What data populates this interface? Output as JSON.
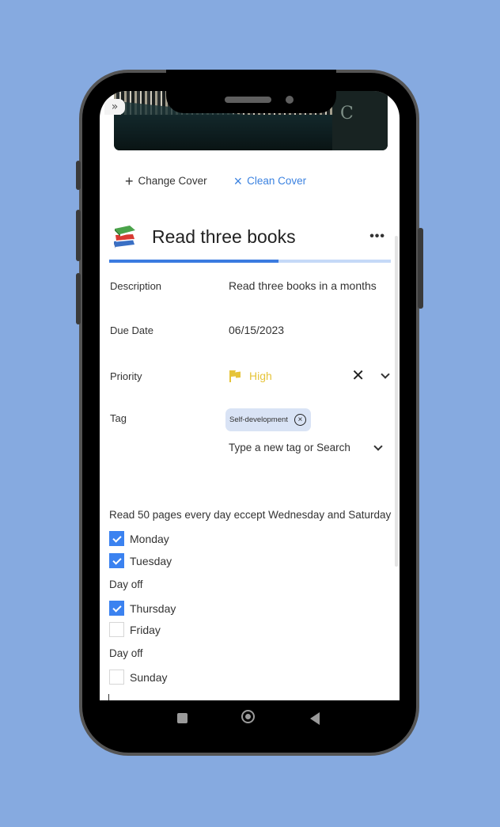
{
  "colors": {
    "background": "#86aae0",
    "accent": "#3b82e0",
    "priority_high": "#e6c43a",
    "tag_chip_bg": "#d9e3f5"
  },
  "cover": {
    "expand_icon": "»",
    "book_letter": "C"
  },
  "cover_actions": {
    "change_icon": "+",
    "change_label": "Change Cover",
    "clean_icon": "×",
    "clean_label": "Clean Cover"
  },
  "task": {
    "emoji": "books-icon",
    "title": "Read three books",
    "more_icon": "•••",
    "progress_percent": 60
  },
  "fields": {
    "description_label": "Description",
    "description_value": "Read three books in a months",
    "due_date_label": "Due Date",
    "due_date_value": "06/15/2023",
    "priority_label": "Priority",
    "priority_value": "High",
    "priority_clear_icon": "✕",
    "tag_label": "Tag",
    "tags": [
      "Self-development"
    ],
    "tag_remove_icon": "×",
    "tag_input_placeholder": "Type a new tag or Search"
  },
  "habit": {
    "title": "Read 50 pages every day eccept Wednesday and Saturday",
    "days": [
      {
        "label": "Monday",
        "checked": true
      },
      {
        "label": "Tuesday",
        "checked": true
      },
      {
        "label": "Day off",
        "type": "note"
      },
      {
        "label": "Thursday",
        "checked": true
      },
      {
        "label": "Friday",
        "checked": false
      },
      {
        "label": "Day off",
        "type": "note"
      },
      {
        "label": "Sunday",
        "checked": false
      }
    ]
  },
  "navbar": {
    "recents": "recents-icon",
    "home": "home-icon",
    "back": "back-icon"
  }
}
